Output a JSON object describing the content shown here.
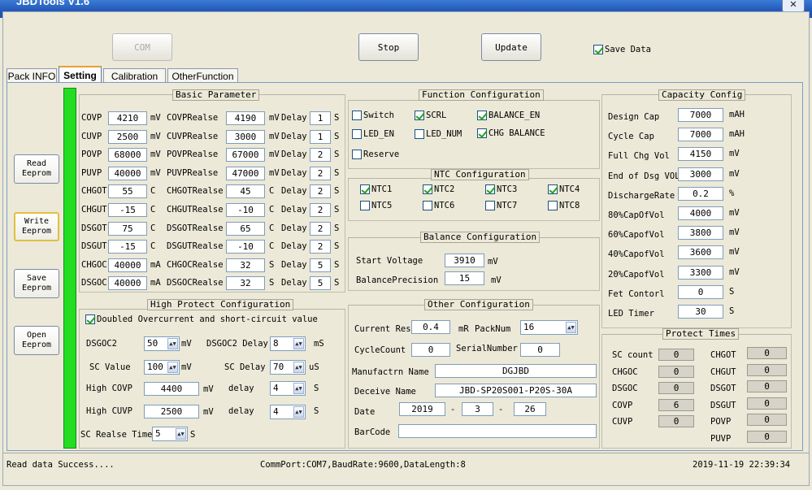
{
  "window": {
    "title": "JBDTools V1.6"
  },
  "toolbar": {
    "com_label": "COM",
    "stop_label": "Stop",
    "update_label": "Update",
    "save_data_label": "Save Data",
    "save_data_checked": true
  },
  "tabs": [
    {
      "label": "Pack INFO",
      "active": false
    },
    {
      "label": "Setting",
      "active": true
    },
    {
      "label": "Calibration",
      "active": false
    },
    {
      "label": "OtherFunction",
      "active": false
    }
  ],
  "side_buttons": [
    {
      "label": "Read\nEeprom"
    },
    {
      "label": "Write\nEeprom"
    },
    {
      "label": "Save\nEeprom"
    },
    {
      "label": "Open\nEeprom"
    }
  ],
  "basic": {
    "title": "Basic Parameter",
    "rows": [
      {
        "name": "COVP",
        "value": "4210",
        "unit": "mV",
        "rname": "COVPRealse",
        "rvalue": "4190",
        "runit": "mV",
        "delay_label": "Delay",
        "delay": "1",
        "dunit": "S"
      },
      {
        "name": "CUVP",
        "value": "2500",
        "unit": "mV",
        "rname": "CUVPRealse",
        "rvalue": "3000",
        "runit": "mV",
        "delay_label": "Delay",
        "delay": "1",
        "dunit": "S"
      },
      {
        "name": "POVP",
        "value": "68000",
        "unit": "mV",
        "rname": "POVPRealse",
        "rvalue": "67000",
        "runit": "mV",
        "delay_label": "Delay",
        "delay": "2",
        "dunit": "S"
      },
      {
        "name": "PUVP",
        "value": "40000",
        "unit": "mV",
        "rname": "PUVPRealse",
        "rvalue": "47000",
        "runit": "mV",
        "delay_label": "Delay",
        "delay": "2",
        "dunit": "S"
      },
      {
        "name": "CHGOT",
        "value": "55",
        "unit": "C",
        "rname": "CHGOTRealse",
        "rvalue": "45",
        "runit": "C",
        "delay_label": "Delay",
        "delay": "2",
        "dunit": "S"
      },
      {
        "name": "CHGUT",
        "value": "-15",
        "unit": "C",
        "rname": "CHGUTRealse",
        "rvalue": "-10",
        "runit": "C",
        "delay_label": "Delay",
        "delay": "2",
        "dunit": "S"
      },
      {
        "name": "DSGOT",
        "value": "75",
        "unit": "C",
        "rname": "DSGOTRealse",
        "rvalue": "65",
        "runit": "C",
        "delay_label": "Delay",
        "delay": "2",
        "dunit": "S"
      },
      {
        "name": "DSGUT",
        "value": "-15",
        "unit": "C",
        "rname": "DSGUTRealse",
        "rvalue": "-10",
        "runit": "C",
        "delay_label": "Delay",
        "delay": "2",
        "dunit": "S"
      },
      {
        "name": "CHGOC",
        "value": "40000",
        "unit": "mA",
        "rname": "CHGOCRealse",
        "rvalue": "32",
        "runit": "S",
        "delay_label": "Delay",
        "delay": "5",
        "dunit": "S"
      },
      {
        "name": "DSGOC",
        "value": "40000",
        "unit": "mA",
        "rname": "DSGOCRealse",
        "rvalue": "32",
        "runit": "S",
        "delay_label": "Delay",
        "delay": "5",
        "dunit": "S"
      }
    ]
  },
  "high": {
    "title": "High Protect Configuration",
    "doubled_label": "Doubled Overcurrent and short-circuit value",
    "doubled_checked": true,
    "dsgoc2_label": "DSGOC2",
    "dsgoc2": "50",
    "dsgoc2_unit": "mV",
    "dsgoc2_delay_label": "DSGOC2 Delay",
    "dsgoc2_delay": "8",
    "dsgoc2_delay_unit": "mS",
    "sc_label": "SC Value",
    "sc": "100",
    "sc_unit": "mV",
    "sc_delay_label": "SC Delay",
    "sc_delay": "70",
    "sc_delay_unit": "uS",
    "hcovp_label": "High COVP",
    "hcovp": "4400",
    "hcovp_unit": "mV",
    "hcovp_delay_label": "delay",
    "hcovp_delay": "4",
    "hcovp_delay_unit": "S",
    "hcuvp_label": "High CUVP",
    "hcuvp": "2500",
    "hcuvp_unit": "mV",
    "hcuvp_delay_label": "delay",
    "hcuvp_delay": "4",
    "hcuvp_delay_unit": "S",
    "screl_label": "SC Realse Time",
    "screl": "5",
    "screl_unit": "S"
  },
  "func": {
    "title": "Function Configuration",
    "items": [
      {
        "label": "Switch",
        "checked": false
      },
      {
        "label": "SCRL",
        "checked": true
      },
      {
        "label": "BALANCE_EN",
        "checked": true
      },
      {
        "label": "LED_EN",
        "checked": false
      },
      {
        "label": "LED_NUM",
        "checked": false
      },
      {
        "label": "CHG BALANCE",
        "checked": true
      },
      {
        "label": "Reserve",
        "checked": false
      }
    ]
  },
  "ntc": {
    "title": "NTC Configuration",
    "items": [
      {
        "label": "NTC1",
        "checked": true
      },
      {
        "label": "NTC2",
        "checked": true
      },
      {
        "label": "NTC3",
        "checked": true
      },
      {
        "label": "NTC4",
        "checked": true
      },
      {
        "label": "NTC5",
        "checked": false
      },
      {
        "label": "NTC6",
        "checked": false
      },
      {
        "label": "NTC7",
        "checked": false
      },
      {
        "label": "NTC8",
        "checked": false
      }
    ]
  },
  "balance": {
    "title": "Balance Configuration",
    "start_label": "Start Voltage",
    "start": "3910",
    "start_unit": "mV",
    "prec_label": "BalancePrecision",
    "prec": "15",
    "prec_unit": "mV"
  },
  "other": {
    "title": "Other Configuration",
    "cres_label": "Current Res",
    "cres": "0.4",
    "cres_unit": "mR",
    "packnum_label": "PackNum",
    "packnum": "16",
    "cycle_label": "CycleCount",
    "cycle": "0",
    "serial_label": "SerialNumber",
    "serial": "0",
    "manu_label": "Manufactrn Name",
    "manu": "DGJBD",
    "device_label": "Deceive Name",
    "device": "JBD-SP20S001-P20S-30A",
    "date_label": "Date",
    "year": "2019",
    "month": "3",
    "day": "26",
    "dash": "-",
    "barcode_label": "BarCode",
    "barcode": ""
  },
  "capacity": {
    "title": "Capacity Config",
    "rows": [
      {
        "label": "Design Cap",
        "value": "7000",
        "unit": "mAH"
      },
      {
        "label": "Cycle Cap",
        "value": "7000",
        "unit": "mAH"
      },
      {
        "label": "Full Chg Vol",
        "value": "4150",
        "unit": "mV"
      },
      {
        "label": "End of Dsg VOL",
        "value": "3000",
        "unit": "mV"
      },
      {
        "label": "DischargeRate",
        "value": "0.2",
        "unit": "%"
      },
      {
        "label": "80%CapOfVol",
        "value": "4000",
        "unit": "mV"
      },
      {
        "label": "60%CapofVol",
        "value": "3800",
        "unit": "mV"
      },
      {
        "label": "40%CapofVol",
        "value": "3600",
        "unit": "mV"
      },
      {
        "label": "20%CapofVol",
        "value": "3300",
        "unit": "mV"
      },
      {
        "label": "Fet Contorl",
        "value": "0",
        "unit": "S"
      },
      {
        "label": "LED Timer",
        "value": "30",
        "unit": "S"
      }
    ]
  },
  "protect": {
    "title": "Protect Times",
    "left": [
      {
        "label": "SC count",
        "value": "0"
      },
      {
        "label": "CHGOC",
        "value": "0"
      },
      {
        "label": "DSGOC",
        "value": "0"
      },
      {
        "label": "COVP",
        "value": "6"
      },
      {
        "label": "CUVP",
        "value": "0"
      }
    ],
    "right": [
      {
        "label": "CHGOT",
        "value": "0"
      },
      {
        "label": "CHGUT",
        "value": "0"
      },
      {
        "label": "DSGOT",
        "value": "0"
      },
      {
        "label": "DSGUT",
        "value": "0"
      },
      {
        "label": "POVP",
        "value": "0"
      },
      {
        "label": "PUVP",
        "value": "0"
      }
    ]
  },
  "status": {
    "message": "Read data Success....",
    "comm": "CommPort:COM7,BaudRate:9600,DataLength:8",
    "datetime": "2019-11-19 22:39:34"
  }
}
